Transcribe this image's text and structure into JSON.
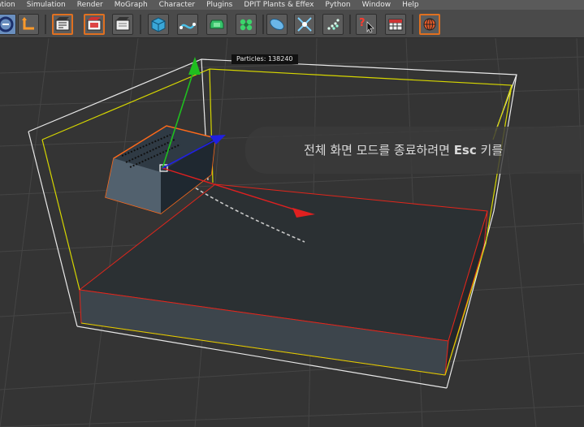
{
  "menu": {
    "items": [
      "ation",
      "Simulation",
      "Render",
      "MoGraph",
      "Character",
      "Plugins",
      "DPIT Plants & Effex",
      "Python",
      "Window",
      "Help"
    ]
  },
  "toolbar": {
    "buttons": [
      {
        "name": "undo-view-icon"
      },
      {
        "name": "axis-move-icon"
      },
      {
        "name": "render-view-icon"
      },
      {
        "name": "render-picture-viewer-icon"
      },
      {
        "name": "render-settings-icon"
      },
      {
        "name": "cube-primitive-icon"
      },
      {
        "name": "spline-tool-icon"
      },
      {
        "name": "nurbs-icon"
      },
      {
        "name": "array-cloner-icon"
      },
      {
        "name": "deformer-icon"
      },
      {
        "name": "scene-environment-icon"
      },
      {
        "name": "particles-emitter-icon"
      },
      {
        "name": "help-pointer-icon"
      },
      {
        "name": "layout-table-icon"
      },
      {
        "name": "sphere-render-icon"
      }
    ]
  },
  "viewport": {
    "particles_label": "Particles: 138240",
    "fullscreen_message": "전체 화면 모드를 종료하려면",
    "fullscreen_key": "Esc",
    "fullscreen_suffix": "키를"
  },
  "colors": {
    "background": "#343434",
    "bbox_white": "#e8e8e8",
    "bbox_yellow": "#d6d600",
    "selection_red": "#e0261c",
    "emitter_orange": "#ff6a1a",
    "axis_y": "#1fbf1f",
    "axis_x": "#e02020",
    "axis_z": "#2020e0"
  }
}
